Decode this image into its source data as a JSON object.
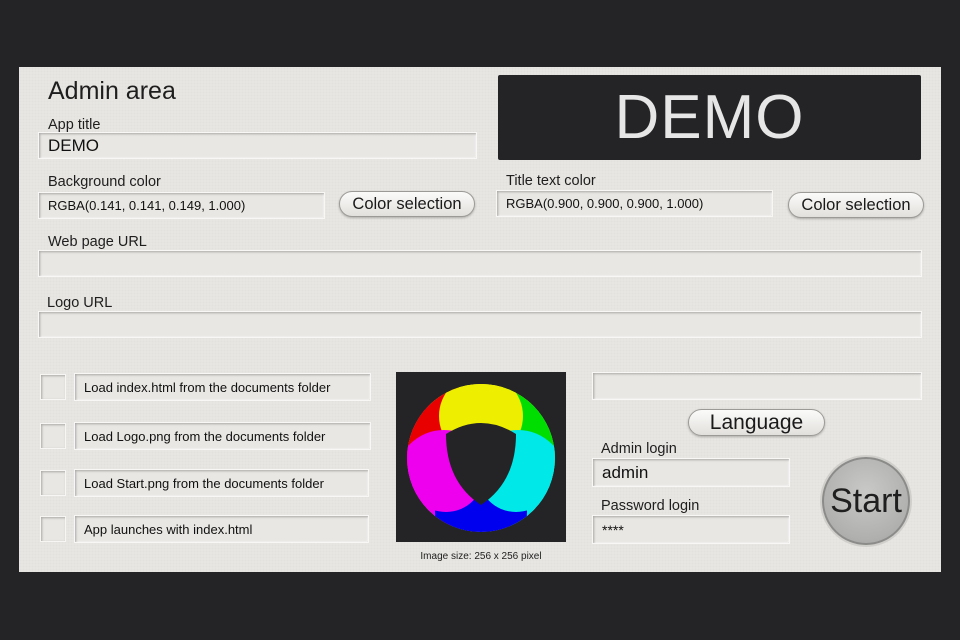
{
  "admin": {
    "title": "Admin area",
    "app_title_label": "App title",
    "app_title_value": "DEMO",
    "demo_preview": "DEMO",
    "bg_color_label": "Background color",
    "bg_color_value": "RGBA(0.141, 0.141, 0.149, 1.000)",
    "bg_color_button": "Color selection",
    "title_color_label": "Title text color",
    "title_color_value": "RGBA(0.900, 0.900, 0.900, 1.000)",
    "title_color_button": "Color selection",
    "web_url_label": "Web page URL",
    "web_url_value": "",
    "logo_url_label": "Logo URL",
    "logo_url_value": "",
    "options": [
      {
        "label": "Load index.html from the documents folder",
        "checked": false
      },
      {
        "label": "Load Logo.png from the documents folder",
        "checked": false
      },
      {
        "label": "Load Start.png from the documents folder",
        "checked": false
      },
      {
        "label": "App launches with index.html",
        "checked": false
      }
    ],
    "image_size": "Image size: 256 x 256 pixel",
    "language_value": "",
    "language_button": "Language",
    "admin_login_label": "Admin login",
    "admin_login_value": "admin",
    "password_label": "Password login",
    "password_value": "****",
    "start_button": "Start",
    "colors": {
      "background": "#242426",
      "panel": "#e8e6e2",
      "title_text": "#e6e6e6"
    }
  }
}
